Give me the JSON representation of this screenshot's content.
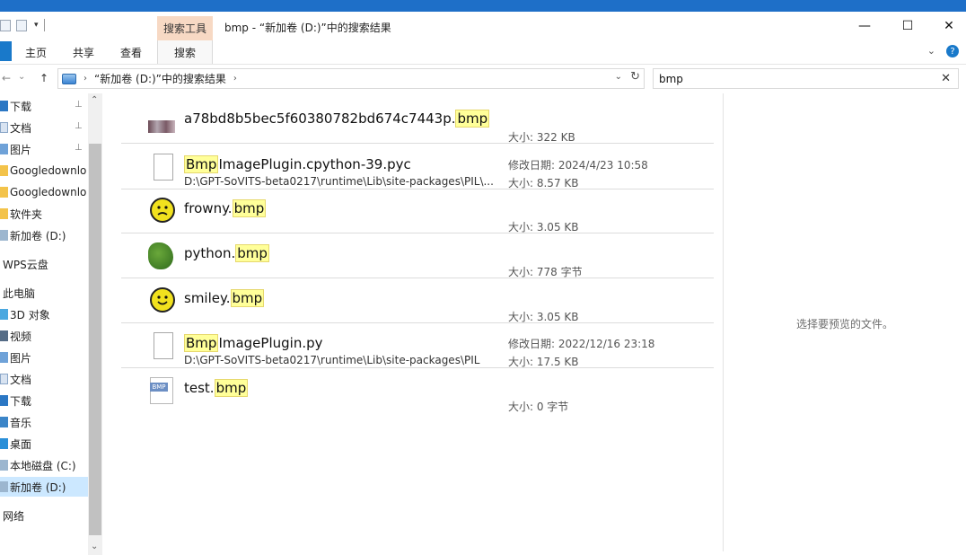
{
  "window": {
    "title": "bmp - “新加卷 (D:)”中的搜索结果",
    "context_tab_header": "搜索工具",
    "controls": {
      "minimize": "—",
      "maximize": "☐",
      "close": "✕"
    }
  },
  "ribbon": {
    "tabs": [
      "主页",
      "共享",
      "查看",
      "搜索"
    ],
    "active_tab": "搜索",
    "expand": "⌄",
    "help": "?"
  },
  "address": {
    "crumb": "“新加卷 (D:)”中的搜索结果",
    "back": "←",
    "forward": "→",
    "recent": "⌄",
    "up": "↑",
    "separator": "›",
    "crumb_arrow": "›",
    "dropdown": "⌄",
    "refresh": "↻"
  },
  "search": {
    "value": "bmp",
    "clear": "✕"
  },
  "nav": {
    "items": [
      {
        "label": "下载",
        "icon": "download-icon",
        "pinned": true
      },
      {
        "label": "文档",
        "icon": "document-icon",
        "pinned": true
      },
      {
        "label": "图片",
        "icon": "picture-icon",
        "pinned": true
      },
      {
        "label": "Googledownlo",
        "icon": "folder-icon",
        "pinned": false
      },
      {
        "label": "Googledownlo",
        "icon": "folder-icon",
        "pinned": false
      },
      {
        "label": "软件夹",
        "icon": "folder-icon",
        "pinned": false
      },
      {
        "label": "新加卷 (D:)",
        "icon": "drive-icon",
        "pinned": false
      },
      {
        "label": "WPS云盘",
        "icon": "cloud-icon",
        "pinned": false
      },
      {
        "label": "此电脑",
        "icon": "computer-icon",
        "pinned": false
      },
      {
        "label": "3D 对象",
        "icon": "3d-objects-icon",
        "pinned": false
      },
      {
        "label": "视频",
        "icon": "video-icon",
        "pinned": false
      },
      {
        "label": "图片",
        "icon": "picture-icon",
        "pinned": false
      },
      {
        "label": "文档",
        "icon": "document-icon",
        "pinned": false
      },
      {
        "label": "下载",
        "icon": "download-icon",
        "pinned": false
      },
      {
        "label": "音乐",
        "icon": "music-icon",
        "pinned": false
      },
      {
        "label": "桌面",
        "icon": "desktop-icon",
        "pinned": false
      },
      {
        "label": "本地磁盘 (C:)",
        "icon": "drive-icon",
        "pinned": false
      },
      {
        "label": "新加卷 (D:)",
        "icon": "drive-icon",
        "pinned": false,
        "selected": true
      },
      {
        "label": "网络",
        "icon": "network-icon",
        "pinned": false
      }
    ],
    "pin_glyph": "📌",
    "scroll_up": "⌃",
    "scroll_down": "⌄"
  },
  "results": [
    {
      "name_pre": "a78bd8b5bec5f60380782bd674c7443p.",
      "name_hl": "bmp",
      "name_post": "",
      "path": "",
      "meta1": "",
      "meta2": "大小: 322 KB",
      "icon": "image-thumbnail-icon"
    },
    {
      "name_pre": "",
      "name_hl": "Bmp",
      "name_post": "ImagePlugin.cpython-39.pyc",
      "path": "D:\\GPT-SoVITS-beta0217\\runtime\\Lib\\site-packages\\PIL\\...",
      "meta1": "修改日期: 2024/4/23 10:58",
      "meta2": "大小: 8.57 KB",
      "icon": "document-icon"
    },
    {
      "name_pre": "frowny.",
      "name_hl": "bmp",
      "name_post": "",
      "path": "",
      "meta1": "",
      "meta2": "大小: 3.05 KB",
      "icon": "frowny-face-icon"
    },
    {
      "name_pre": "python.",
      "name_hl": "bmp",
      "name_post": "",
      "path": "",
      "meta1": "",
      "meta2": "大小: 778 字节",
      "icon": "python-snake-icon"
    },
    {
      "name_pre": "smiley.",
      "name_hl": "bmp",
      "name_post": "",
      "path": "",
      "meta1": "",
      "meta2": "大小: 3.05 KB",
      "icon": "smiley-face-icon"
    },
    {
      "name_pre": "",
      "name_hl": "Bmp",
      "name_post": "ImagePlugin.py",
      "path": "D:\\GPT-SoVITS-beta0217\\runtime\\Lib\\site-packages\\PIL",
      "meta1": "修改日期: 2022/12/16 23:18",
      "meta2": "大小: 17.5 KB",
      "icon": "document-icon"
    },
    {
      "name_pre": "test.",
      "name_hl": "bmp",
      "name_post": "",
      "path": "",
      "meta1": "",
      "meta2": "大小: 0 字节",
      "icon": "bmp-file-icon"
    }
  ],
  "preview": {
    "empty_text": "选择要预览的文件。"
  },
  "colors": {
    "accent": "#1e6fc8",
    "highlight": "#ffff99",
    "selected": "#cce8ff",
    "context_tab": "#f7d9c4"
  }
}
